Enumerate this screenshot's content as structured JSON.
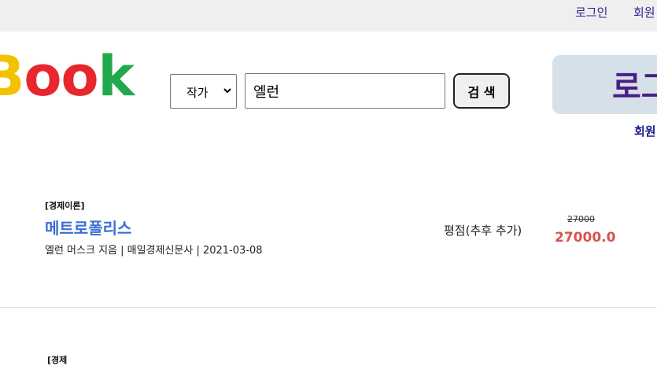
{
  "topbar": {
    "login_label": "로그인",
    "join_label": "회원"
  },
  "logo": {
    "part1": "B",
    "part2": "o",
    "part3": "o",
    "part4": "k"
  },
  "search": {
    "select_value": "작가",
    "query": "엘런",
    "button_label": "검 색"
  },
  "login_panel": {
    "label": "로그",
    "join_label": "회원"
  },
  "results": [
    {
      "category": "[경제이론]",
      "title": "메트로폴리스",
      "meta": "엘런 머스크 지음 | 매일경제신문사 | 2021-03-08",
      "rating": "평점(추후 추가)",
      "original_price": "27000",
      "sale_price": "27000.0"
    }
  ],
  "next_item": {
    "category_partial": "[경제"
  }
}
